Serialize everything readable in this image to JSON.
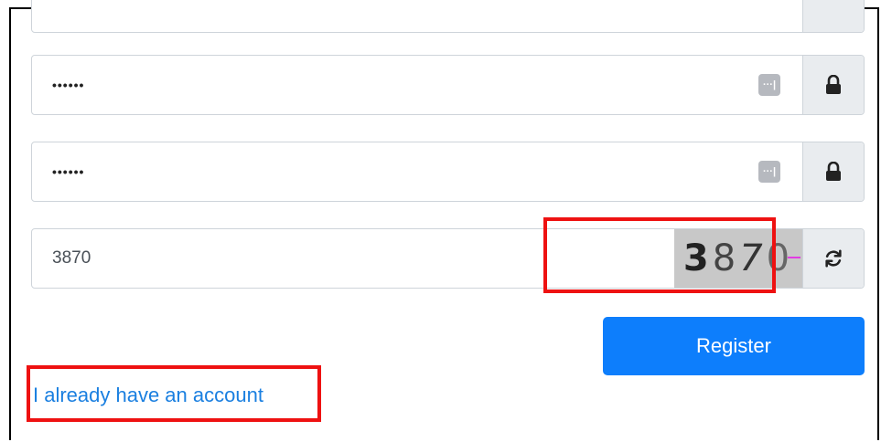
{
  "form": {
    "password": {
      "value": "••••••",
      "manager_icon_label": "···|"
    },
    "confirm_password": {
      "value": "••••••",
      "manager_icon_label": "···|"
    },
    "captcha": {
      "value": "3870",
      "image_digits": [
        "3",
        "8",
        "7",
        "0"
      ]
    },
    "register_label": "Register",
    "login_link_label": "I already have an account"
  },
  "colors": {
    "primary": "#0d7efc",
    "link": "#1a7fe0",
    "addon_bg": "#e9ecef",
    "highlight": "#ee1111"
  }
}
